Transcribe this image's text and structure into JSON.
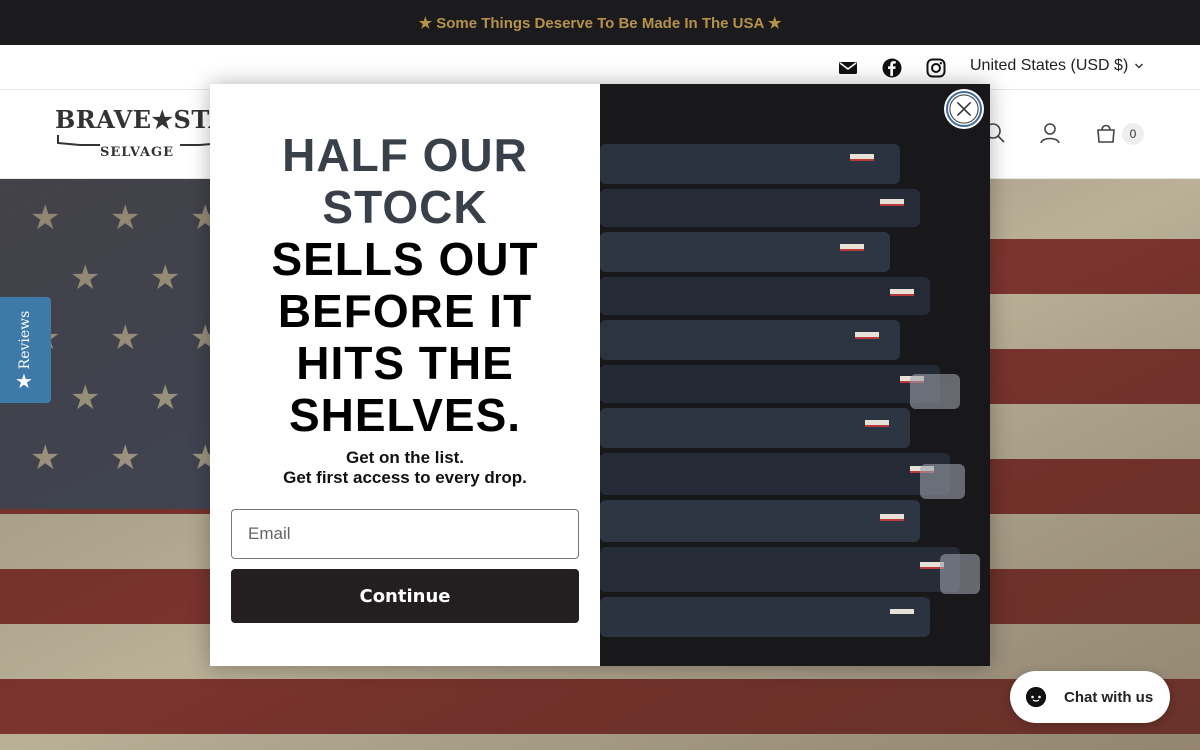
{
  "announcement": {
    "text": "★ Some Things Deserve To Be Made In The USA ★"
  },
  "utility_bar": {
    "icons": [
      "mail-icon",
      "facebook-icon",
      "instagram-icon"
    ],
    "currency": "United States (USD $)"
  },
  "header": {
    "logo": {
      "top": "BRAVE★STAR",
      "bottom": "SELVAGE"
    },
    "icons": [
      "search-icon",
      "account-icon",
      "cart-icon"
    ],
    "cart_count": "0"
  },
  "reviews_tab": {
    "label": "Reviews",
    "star": "★"
  },
  "popup": {
    "headline_gray": [
      "HALF OUR",
      "STOCK"
    ],
    "headline_black": [
      "SELLS OUT",
      "BEFORE IT",
      "HITS THE",
      "SHELVES."
    ],
    "subtext_line1": "Get on the list.",
    "subtext_line2": "Get first access to every drop.",
    "email_placeholder": "Email",
    "continue_label": "Continue"
  },
  "chat": {
    "label": "Chat with us"
  },
  "colors": {
    "announce_bg": "#1b1b1d",
    "announce_text": "#b59248",
    "reviews_tab": "#3d7aa8",
    "button_dark": "#231f20",
    "close_ring": "#3d6e9e"
  }
}
